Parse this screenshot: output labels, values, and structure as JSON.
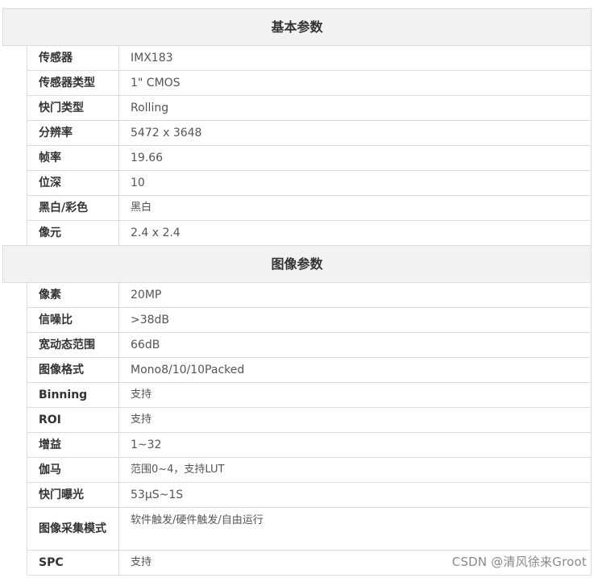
{
  "sections": [
    {
      "title": "基本参数",
      "rows": [
        {
          "key": "传感器",
          "value": "IMX183"
        },
        {
          "key": "传感器类型",
          "value": "1\" CMOS"
        },
        {
          "key": "快门类型",
          "value": "Rolling"
        },
        {
          "key": "分辨率",
          "value": "5472 x 3648"
        },
        {
          "key": "帧率",
          "value": "19.66"
        },
        {
          "key": "位深",
          "value": "10"
        },
        {
          "key": "黑白/彩色",
          "value": "黑白"
        },
        {
          "key": "像元",
          "value": "2.4 x 2.4"
        }
      ]
    },
    {
      "title": "图像参数",
      "rows": [
        {
          "key": "像素",
          "value": "20MP"
        },
        {
          "key": "信噪比",
          "value": ">38dB"
        },
        {
          "key": "宽动态范围",
          "value": "66dB"
        },
        {
          "key": "图像格式",
          "value": "Mono8/10/10Packed"
        },
        {
          "key": "Binning",
          "value": "支持"
        },
        {
          "key": "ROI",
          "value": "支持"
        },
        {
          "key": "增益",
          "value": "1~32"
        },
        {
          "key": "伽马",
          "value": "范围0~4，支持LUT"
        },
        {
          "key": "快门曝光",
          "value": "53μS~1S"
        },
        {
          "key": "图像采集模式",
          "value": "软件触发/硬件触发/自由运行"
        },
        {
          "key": "SPC",
          "value": "支持"
        }
      ]
    }
  ],
  "watermark": "CSDN @清风徐来Groot"
}
